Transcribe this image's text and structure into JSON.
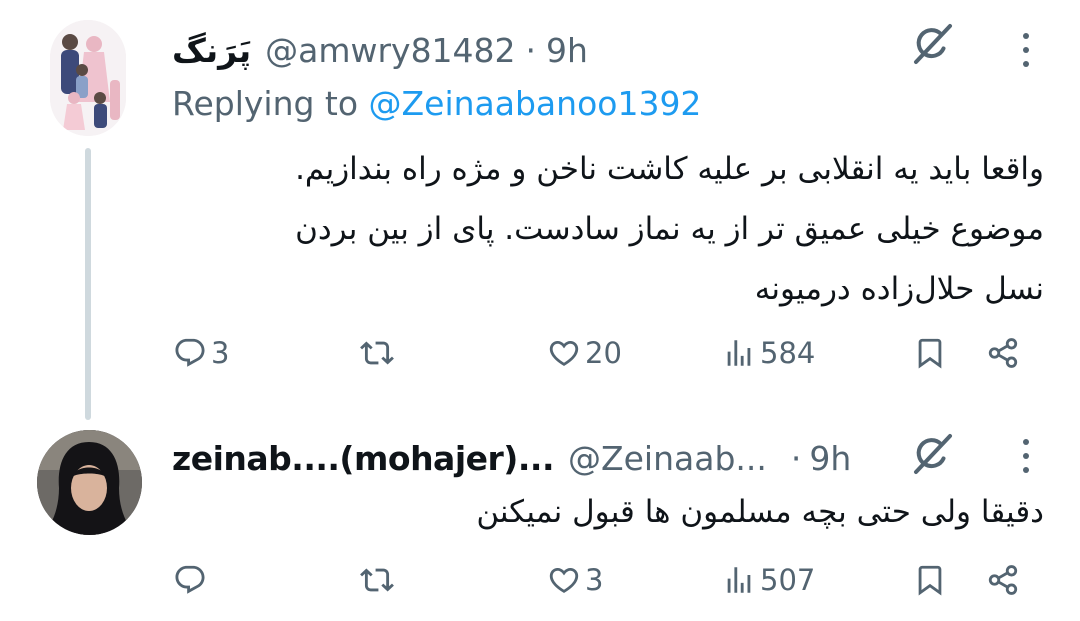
{
  "tweets": [
    {
      "display_name": "پَرَنگ",
      "handle": "@amwry81482",
      "separator": "·",
      "time": "9h",
      "replying_prefix": "Replying to ",
      "replying_to": "@Zeinaabanoo1392",
      "body_lines": [
        "واقعا باید یه انقلابی بر علیه کاشت ناخن و مژه راه بندازیم.",
        "موضوع خیلی عمیق تر از یه نماز سادست. پای از بین بردن",
        "نسل حلال‌زاده درمیونه"
      ],
      "replies": "3",
      "retweets": "",
      "likes": "20",
      "views": "584"
    },
    {
      "display_name": "zeinab....(mohajer)...",
      "handle": "@Zeinaab...",
      "separator": "·",
      "time": "9h",
      "body_lines": [
        "دقیقا ولی حتی بچه مسلمون ها قبول نمیکنن"
      ],
      "replies": "",
      "retweets": "",
      "likes": "3",
      "views": "507"
    }
  ],
  "icons": {
    "grok": "grok-icon",
    "more": "more-icon",
    "reply": "reply-icon",
    "retweet": "retweet-icon",
    "like": "heart-icon",
    "views": "views-icon",
    "bookmark": "bookmark-icon",
    "share": "share-icon"
  },
  "colors": {
    "text": "#0f1419",
    "secondary": "#536471",
    "link": "#1d9bf0",
    "thread_line": "#cfd9de"
  }
}
